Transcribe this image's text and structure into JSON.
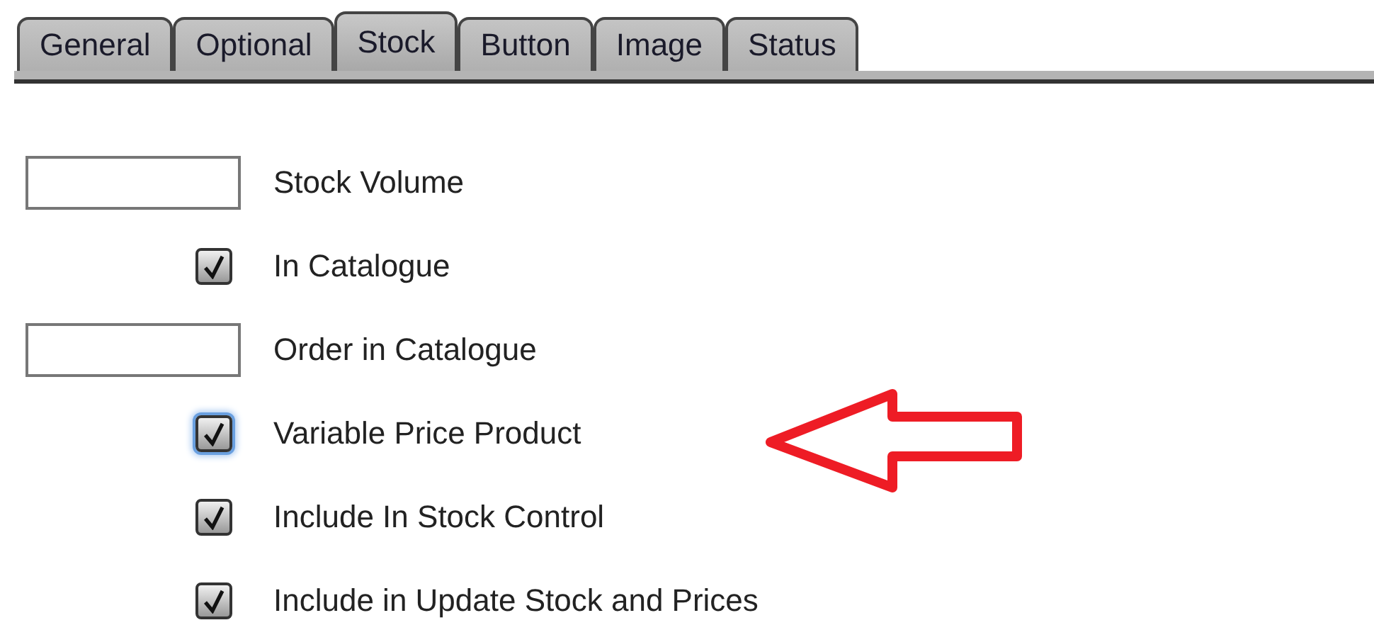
{
  "tabs": [
    {
      "label": "General",
      "selected": false
    },
    {
      "label": "Optional",
      "selected": false
    },
    {
      "label": "Stock",
      "selected": true
    },
    {
      "label": "Button",
      "selected": false
    },
    {
      "label": "Image",
      "selected": false
    },
    {
      "label": "Status",
      "selected": false
    }
  ],
  "rows": [
    {
      "kind": "field",
      "label": "Stock Volume"
    },
    {
      "kind": "checkbox",
      "label": "In Catalogue",
      "checked": true,
      "focused": false
    },
    {
      "kind": "field",
      "label": "Order in Catalogue"
    },
    {
      "kind": "checkbox",
      "label": "Variable Price Product",
      "checked": true,
      "focused": true
    },
    {
      "kind": "checkbox",
      "label": "Include In Stock Control",
      "checked": true,
      "focused": false
    },
    {
      "kind": "checkbox",
      "label": "Include in Update Stock and Prices",
      "checked": true,
      "focused": false
    }
  ]
}
